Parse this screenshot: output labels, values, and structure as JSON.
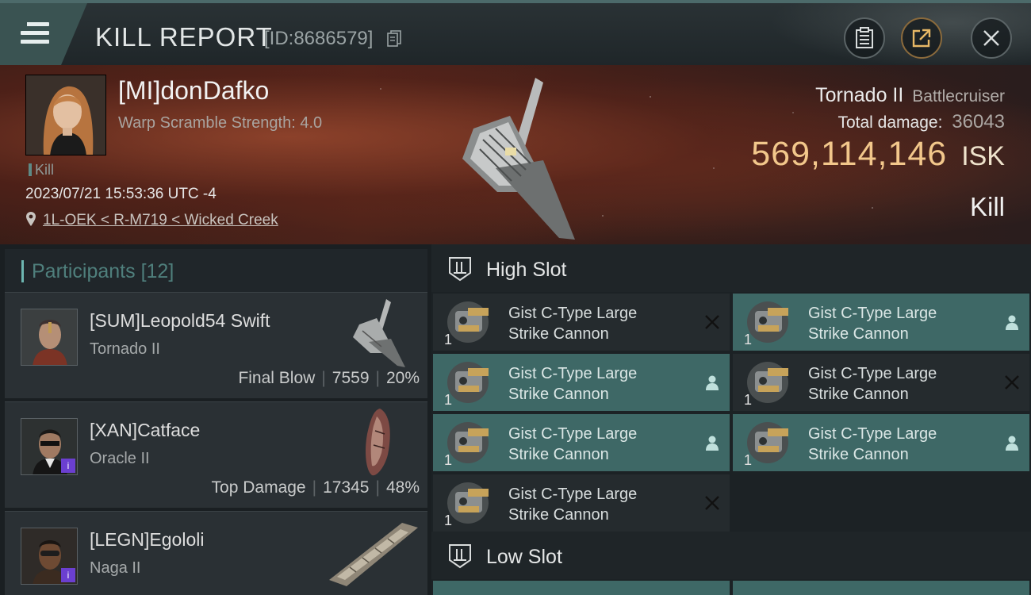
{
  "header": {
    "title": "KILL REPORT",
    "report_id": "[ID:8686579]"
  },
  "victim": {
    "name": "[MI]donDafko",
    "warp_scramble": "Warp Scramble Strength: 4.0",
    "kill_tag": "Kill",
    "datetime": "2023/07/21 15:53:36 UTC -4",
    "location": "1L-OEK < R-M719 < Wicked Creek",
    "ship_name": "Tornado II",
    "ship_class": "Battlecruiser",
    "total_damage_label": "Total damage:",
    "total_damage": "36043",
    "isk_value": "569,114,146",
    "isk_unit": "ISK",
    "result": "Kill"
  },
  "participants": {
    "label": "Participants",
    "count": "[12]",
    "rows": [
      {
        "name": "[SUM]Leopold54 Swift",
        "ship": "Tornado II",
        "role": "Final Blow",
        "damage": "7559",
        "percent": "20%"
      },
      {
        "name": "[XAN]Catface",
        "ship": "Oracle II",
        "role": "Top Damage",
        "damage": "17345",
        "percent": "48%"
      },
      {
        "name": "[LEGN]Egololi",
        "ship": "Naga II",
        "role": "",
        "damage": "",
        "percent": ""
      }
    ]
  },
  "fittings": {
    "high_slot_label": "High Slot",
    "low_slot_label": "Low Slot",
    "modules": [
      {
        "name_line1": "Gist C-Type Large",
        "name_line2": "Strike Cannon",
        "qty": "1",
        "status": "destroyed"
      },
      {
        "name_line1": "Gist C-Type Large",
        "name_line2": "Strike Cannon",
        "qty": "1",
        "status": "dropped"
      },
      {
        "name_line1": "Gist C-Type Large",
        "name_line2": "Strike Cannon",
        "qty": "1",
        "status": "dropped"
      },
      {
        "name_line1": "Gist C-Type Large",
        "name_line2": "Strike Cannon",
        "qty": "1",
        "status": "destroyed"
      },
      {
        "name_line1": "Gist C-Type Large",
        "name_line2": "Strike Cannon",
        "qty": "1",
        "status": "dropped"
      },
      {
        "name_line1": "Gist C-Type Large",
        "name_line2": "Strike Cannon",
        "qty": "1",
        "status": "dropped"
      },
      {
        "name_line1": "Gist C-Type Large",
        "name_line2": "Strike Cannon",
        "qty": "1",
        "status": "destroyed"
      }
    ]
  },
  "colors": {
    "accent_teal": "#3e6866",
    "isk_gold": "#f2c78b",
    "participants_label": "#4f7f7c"
  },
  "icons": [
    "menu-icon",
    "copy-icon",
    "clipboard-icon",
    "share-icon",
    "close-icon",
    "location-pin-icon",
    "high-slot-icon",
    "low-slot-icon",
    "destroyed-x-icon",
    "dropped-person-icon"
  ]
}
